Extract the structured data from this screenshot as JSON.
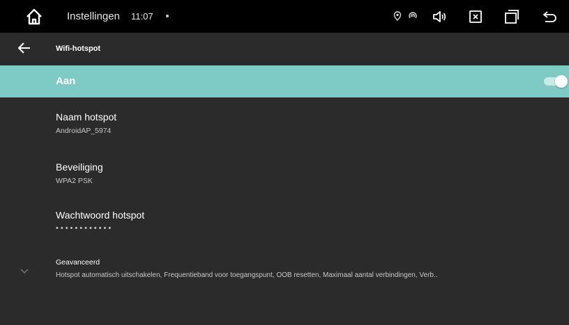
{
  "statusbar": {
    "title": "Instellingen",
    "time": "11:07",
    "icons": [
      "home-icon",
      "location-icon",
      "hotspot-icon",
      "volume-icon",
      "close-app-icon",
      "recent-apps-icon",
      "back-nav-icon"
    ]
  },
  "toolbar": {
    "title": "Wifi-hotspot",
    "back_icon": "arrow-left-icon"
  },
  "master_switch": {
    "label": "Aan",
    "on": true,
    "accent": "#7ecac5"
  },
  "prefs": {
    "name": {
      "title": "Naam hotspot",
      "summary": "AndroidAP_5974"
    },
    "security": {
      "title": "Beveiliging",
      "summary": "WPA2 PSK"
    },
    "password": {
      "title": "Wachtwoord hotspot",
      "summary": "••••••••••••"
    },
    "advanced": {
      "title": "Geavanceerd",
      "summary": "Hotspot automatisch uitschakelen, Frequentieband voor toegangspunt, OOB resetten, Maximaal aantal verbindingen, Verb.."
    }
  }
}
